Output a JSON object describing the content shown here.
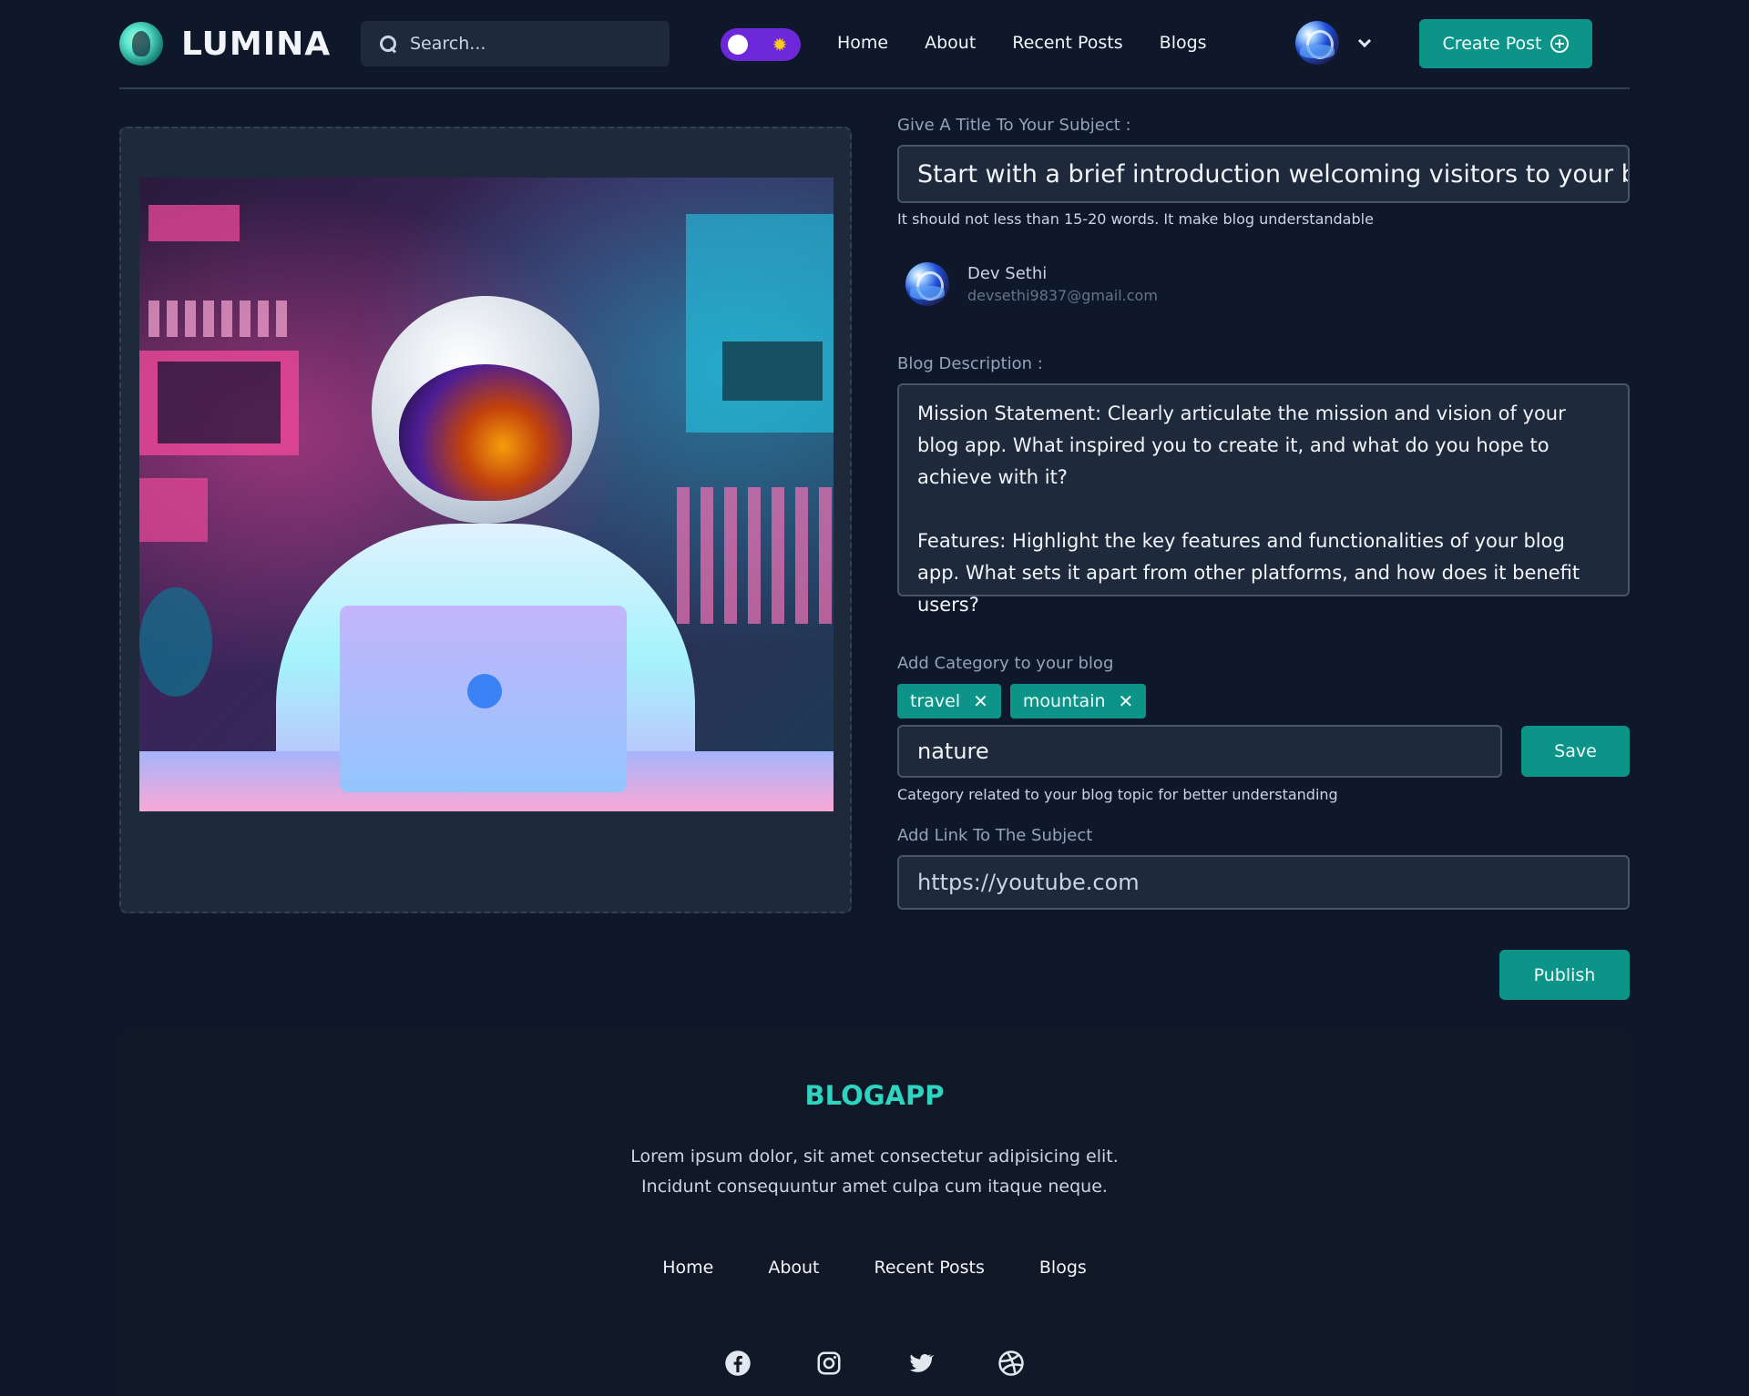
{
  "header": {
    "brand": "LUMINA",
    "search_placeholder": "Search...",
    "nav": [
      "Home",
      "About",
      "Recent Posts",
      "Blogs"
    ],
    "create_post_label": "Create Post"
  },
  "form": {
    "title_label": "Give A Title To Your Subject :",
    "title_value": "Start with a brief introduction welcoming visitors to your b",
    "title_hint": "It should not less than 15-20 words. It make blog understandable",
    "author": {
      "name": "Dev Sethi",
      "email": "devsethi9837@gmail.com"
    },
    "description_label": "Blog Description :",
    "description_paragraphs": [
      "Mission Statement: Clearly articulate the mission and vision of your blog app. What inspired you to create it, and what do you hope to achieve with it?",
      "Features: Highlight the key features and functionalities of your blog app. What sets it apart from other platforms, and how does it benefit users?"
    ],
    "category_label": "Add Category to your blog",
    "categories": [
      "travel",
      "mountain"
    ],
    "category_input_value": "nature",
    "save_label": "Save",
    "category_hint": "Category related to your blog topic for better understanding",
    "link_label": "Add Link To The Subject",
    "link_placeholder": "https://youtube.com",
    "publish_label": "Publish"
  },
  "footer": {
    "brand": "BLOGAPP",
    "text_line1": "Lorem ipsum dolor, sit amet consectetur adipisicing elit.",
    "text_line2": "Incidunt consequuntur amet culpa cum itaque neque.",
    "nav": [
      "Home",
      "About",
      "Recent Posts",
      "Blogs"
    ],
    "socials": [
      "facebook-icon",
      "instagram-icon",
      "twitter-icon",
      "dribbble-icon"
    ]
  },
  "colors": {
    "background": "#0f172a",
    "surface": "#1e293b",
    "accent": "#0d9488",
    "footer_brand": "#2dd4bf",
    "toggle": "#6d28d9"
  }
}
